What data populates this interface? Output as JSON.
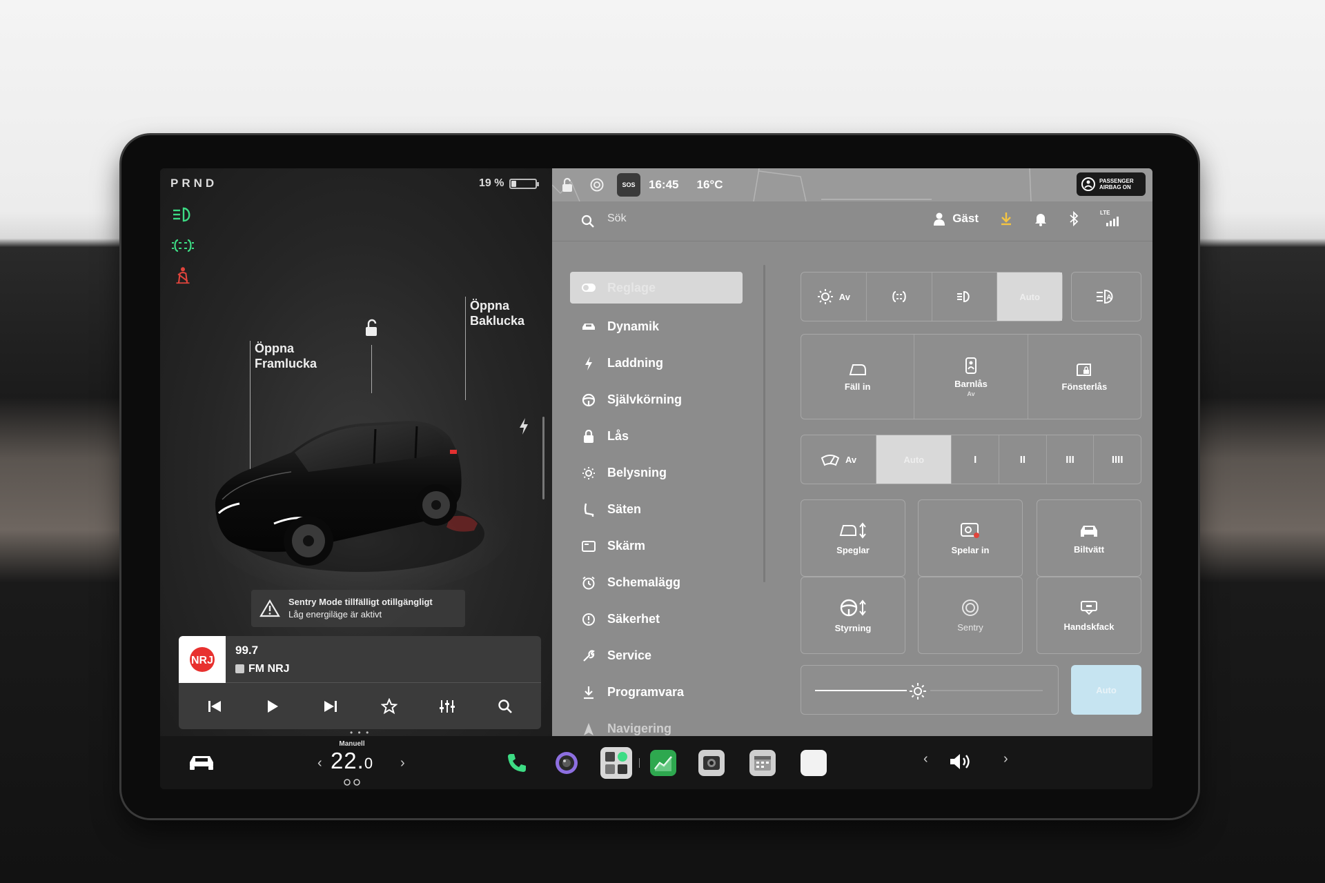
{
  "status": {
    "gear": "PRND",
    "battery_percent": "19 %",
    "battery_level": 0.19,
    "time": "16:45",
    "temperature": "16°C",
    "sos_label": "SOS",
    "airbag_line1": "PASSENGER",
    "airbag_line2": "AIRBAG ON"
  },
  "car_view": {
    "front_trunk_line1": "Öppna",
    "front_trunk_line2": "Framlucka",
    "rear_trunk_line1": "Öppna",
    "rear_trunk_line2": "Baklucka",
    "warning_title": "Sentry Mode tillfälligt otillgängligt",
    "warning_subtitle": "Låg energiläge är aktivt"
  },
  "media": {
    "frequency": "99.7",
    "station": "FM NRJ",
    "logo_text": "NRJ"
  },
  "top": {
    "search_placeholder": "Sök",
    "profile": "Gäst",
    "lte": "LTE"
  },
  "nav": {
    "items": [
      {
        "label": "Reglage",
        "icon": "toggle-icon"
      },
      {
        "label": "Dynamik",
        "icon": "car-icon"
      },
      {
        "label": "Laddning",
        "icon": "bolt-icon"
      },
      {
        "label": "Självkörning",
        "icon": "steering-icon"
      },
      {
        "label": "Lås",
        "icon": "lock-icon"
      },
      {
        "label": "Belysning",
        "icon": "sun-icon"
      },
      {
        "label": "Säten",
        "icon": "seat-icon"
      },
      {
        "label": "Skärm",
        "icon": "display-icon"
      },
      {
        "label": "Schemalägg",
        "icon": "clock-icon"
      },
      {
        "label": "Säkerhet",
        "icon": "alert-icon"
      },
      {
        "label": "Service",
        "icon": "wrench-icon"
      },
      {
        "label": "Programvara",
        "icon": "download-icon"
      },
      {
        "label": "Navigering",
        "icon": "nav-arrow-icon"
      }
    ]
  },
  "controls": {
    "lights": {
      "off": "Av",
      "auto": "Auto"
    },
    "fold_mirrors": "Fäll in",
    "child_lock": "Barnlås",
    "child_lock_state": "Av",
    "window_lock": "Fönsterlås",
    "wipers": {
      "off": "Av",
      "auto": "Auto",
      "s1": "I",
      "s2": "II",
      "s3": "III",
      "s4": "IIII"
    },
    "mirrors": "Speglar",
    "record": "Spelar in",
    "carwash": "Biltvätt",
    "steering": "Styrning",
    "sentry": "Sentry",
    "glovebox": "Handskfack",
    "brightness_auto": "Auto",
    "brightness_level": 0.45
  },
  "climate": {
    "mode": "Manuell",
    "temp_main": "22.",
    "temp_decimal": "0"
  },
  "colors": {
    "indicator_green": "#3ddc84",
    "seatbelt_red": "#e0443c",
    "download_yellow": "#f5c542",
    "auto_blue": "#c6e4f1"
  }
}
